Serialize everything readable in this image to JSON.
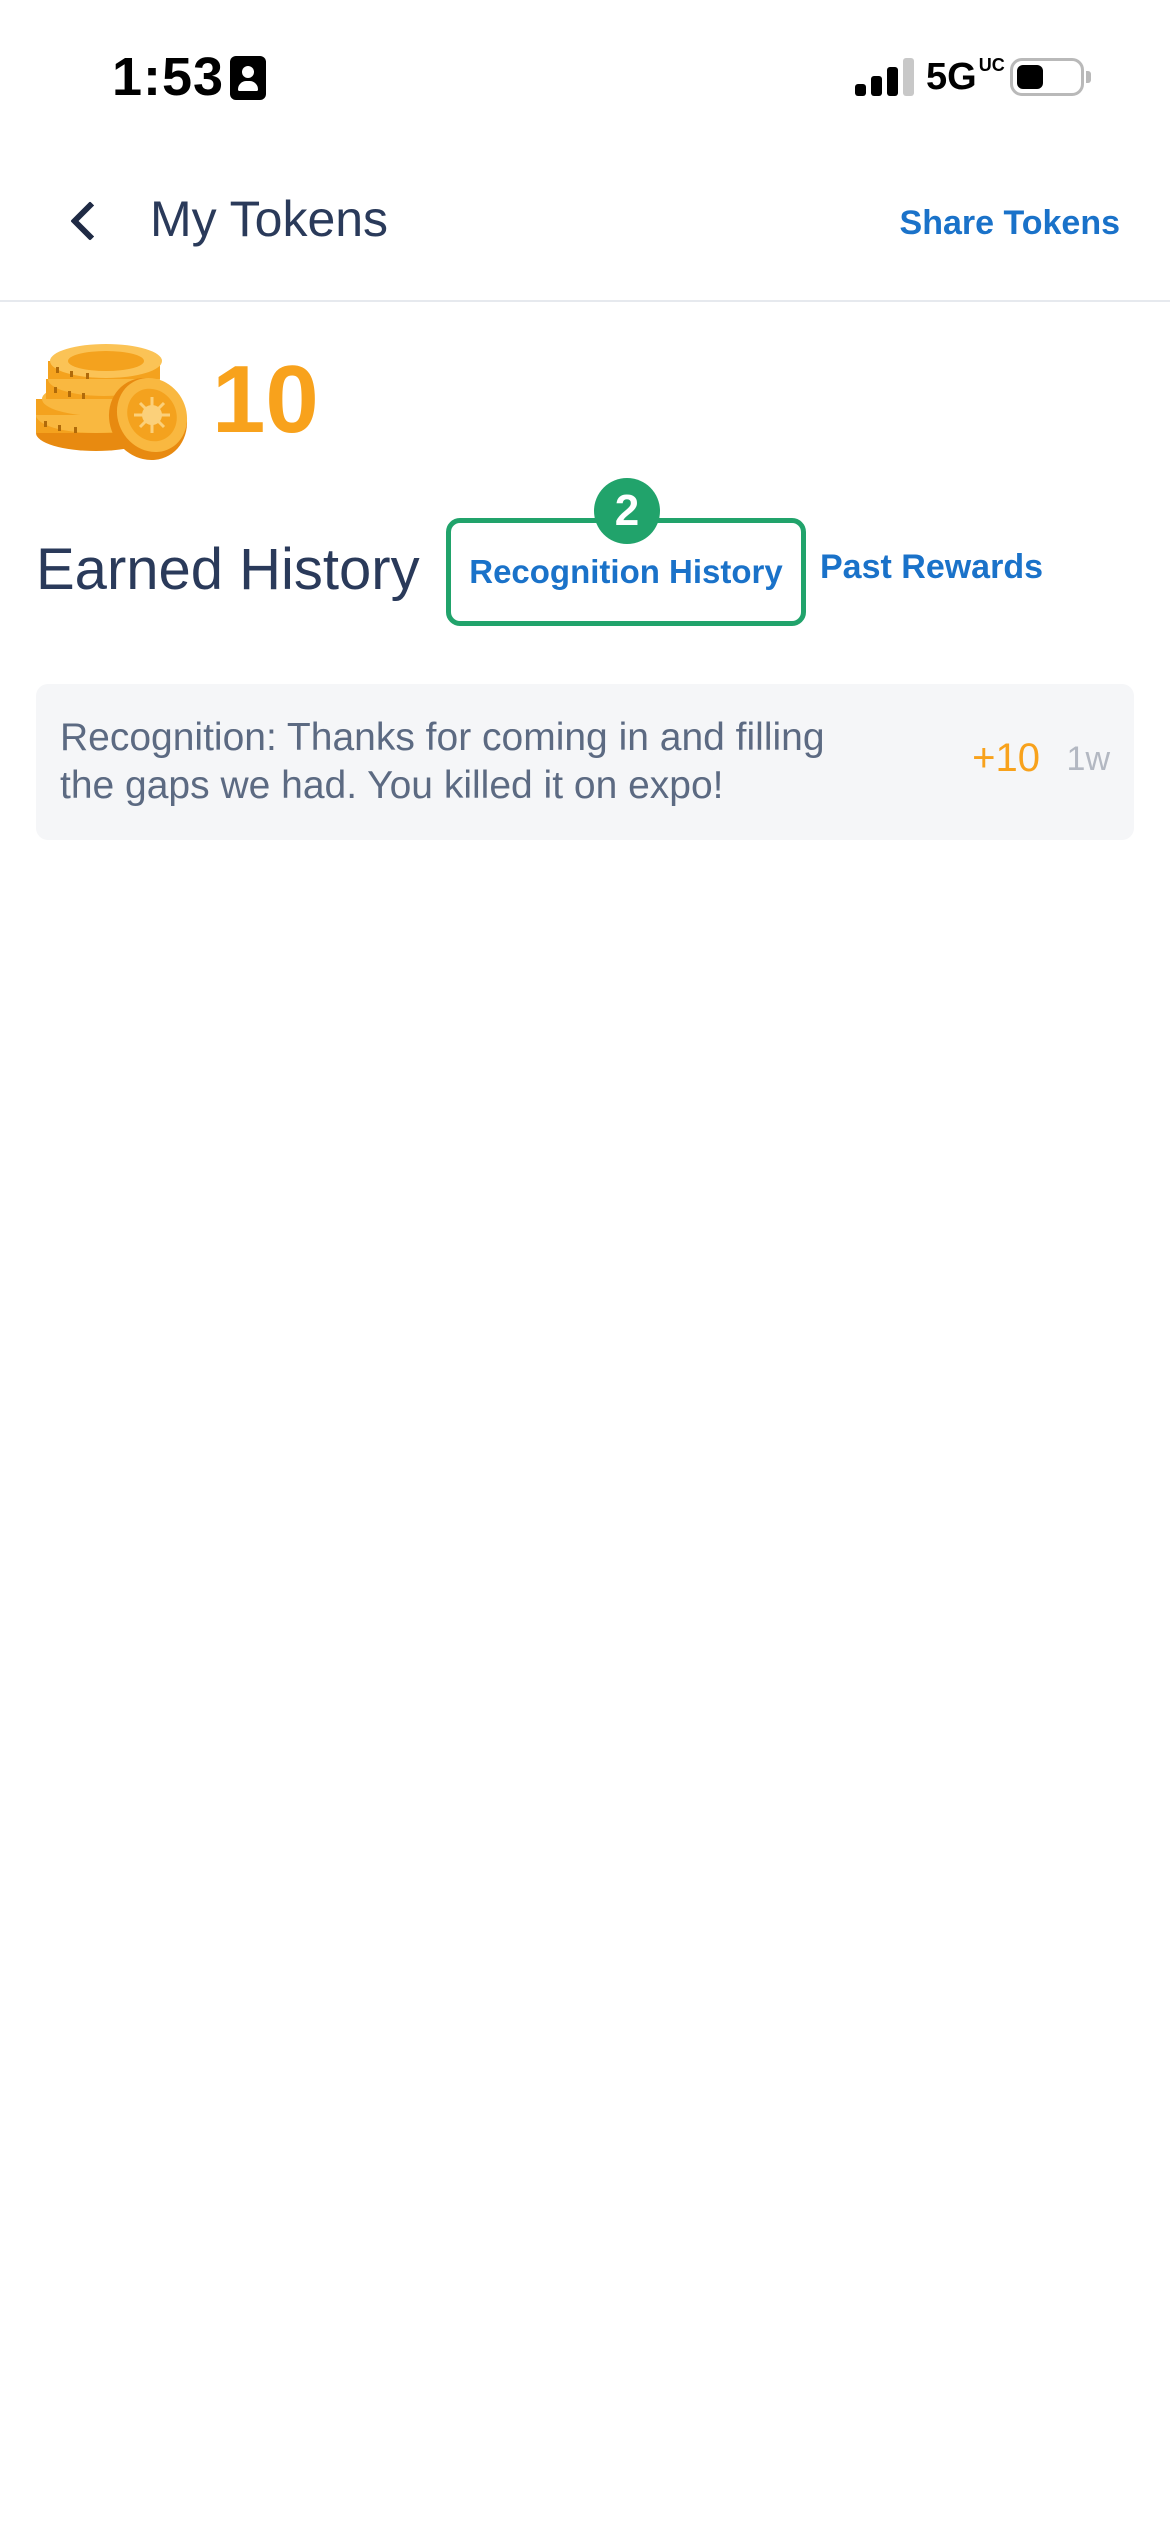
{
  "status_bar": {
    "time": "1:53",
    "network": "5G",
    "network_sup": "UC"
  },
  "header": {
    "title": "My Tokens",
    "share_label": "Share Tokens"
  },
  "tokens": {
    "count": "10"
  },
  "history": {
    "title": "Earned History",
    "tabs": [
      {
        "label": "Recognition History",
        "selected": true,
        "step_badge": "2"
      },
      {
        "label": "Past Rewards",
        "selected": false
      }
    ],
    "items": [
      {
        "text": "Recognition:  Thanks for coming in and filling the gaps we had. You killed it on expo!",
        "points": "+10",
        "time": "1w"
      }
    ]
  },
  "colors": {
    "accent_blue": "#1a72c9",
    "token_orange": "#f8a21c",
    "highlight_green": "#21a36b",
    "title_navy": "#2a3a5a"
  }
}
